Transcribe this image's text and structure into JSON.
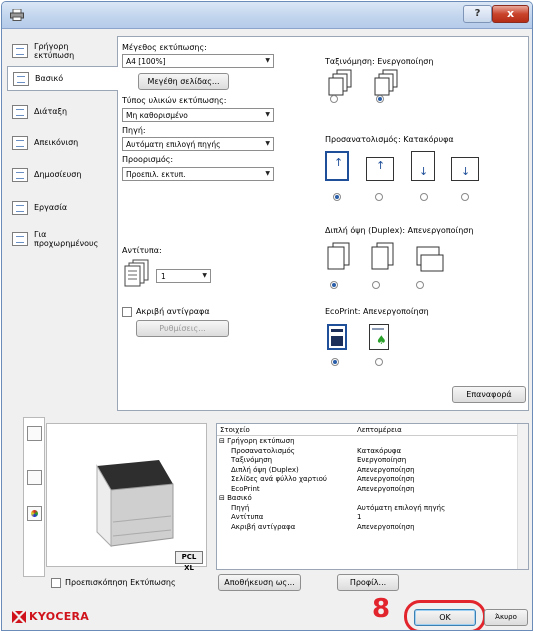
{
  "titlebar": {
    "help": "?",
    "close": "x"
  },
  "nav": [
    {
      "label": "Γρήγορη\nεκτύπωση"
    },
    {
      "label": "Βασικό"
    },
    {
      "label": "Διάταξη"
    },
    {
      "label": "Απεικόνιση"
    },
    {
      "label": "Δημοσίευση"
    },
    {
      "label": "Εργασία"
    },
    {
      "label": "Για\nπροχωρημένους"
    }
  ],
  "basic": {
    "size_label": "Μέγεθος εκτύπωσης:",
    "size_value": "A4 [100%]",
    "page_size_btn": "Μεγέθη σελίδας...",
    "media_label": "Τύπος υλικών εκτύπωσης:",
    "media_value": "Μη καθορισμένο",
    "source_label": "Πηγή:",
    "source_value": "Αυτόματη επιλογή πηγής",
    "dest_label": "Προορισμός:",
    "dest_value": "Προεπιλ. εκτυπ.",
    "copies_label": "Αντίτυπα:",
    "copies_value": "1",
    "collate_label": "Ακριβή αντίγραφα",
    "settings_btn": "Ρυθμίσεις..."
  },
  "right": {
    "collate_title": "Ταξινόμηση: Ενεργοποίηση",
    "orient_title": "Προσανατολισμός: Κατακόρυφα",
    "duplex_title": "Διπλή όψη (Duplex): Απενεργοποίηση",
    "eco_title": "EcoPrint: Απενεργοποίηση",
    "reset_btn": "Επαναφορά"
  },
  "preview": {
    "badge": "PCL XL"
  },
  "table": {
    "col1": "Στοιχείο",
    "col2": "Λεπτομέρεια",
    "rows": [
      {
        "k": "⊟ Γρήγορη εκτύπωση",
        "v": ""
      },
      {
        "k": "Προσανατολισμός",
        "v": "Κατακόρυφα"
      },
      {
        "k": "Ταξινόμηση",
        "v": "Ενεργοποίηση"
      },
      {
        "k": "Διπλή όψη (Duplex)",
        "v": "Απενεργοποίηση"
      },
      {
        "k": "Σελίδες ανά φύλλο χαρτιού",
        "v": "Απενεργοποίηση"
      },
      {
        "k": "EcoPrint",
        "v": "Απενεργοποίηση"
      },
      {
        "k": "⊟ Βασικό",
        "v": ""
      },
      {
        "k": "Πηγή",
        "v": "Αυτόματη επιλογή πηγής"
      },
      {
        "k": "Αντίτυπα",
        "v": "1"
      },
      {
        "k": "Ακριβή αντίγραφα",
        "v": "Απενεργοποίηση"
      }
    ]
  },
  "footer": {
    "preview_check": "Προεπισκόπηση Εκτύπωσης",
    "save_as": "Αποθήκευση ως...",
    "profile": "Προφίλ...",
    "brand": "KYOCERA",
    "step": "8",
    "ok": "OK",
    "cancel": "Άκυρο"
  },
  "colors": {
    "accent": "#1f4f99",
    "highlight": "#e2242c",
    "brand": "#d0121b"
  }
}
